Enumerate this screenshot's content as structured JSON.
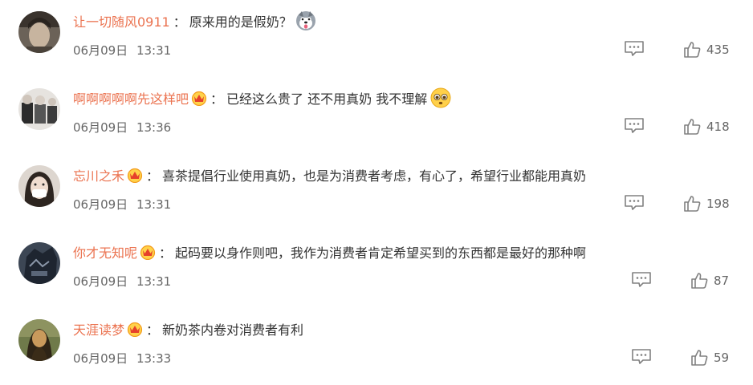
{
  "comments": [
    {
      "user": "让一切随风0911",
      "colon": "：",
      "text": "原来用的是假奶？",
      "emoji": "husky-emoji",
      "date": "06月09日",
      "time": "13:31",
      "likes": "435",
      "vip": false
    },
    {
      "user": "啊啊啊啊啊先这样吧",
      "colon": "：",
      "text": "已经这么贵了 还不用真奶 我不理解",
      "emoji": "pleading-face-emoji",
      "date": "06月09日",
      "time": "13:36",
      "likes": "418",
      "vip": true
    },
    {
      "user": "忘川之禾",
      "colon": "：",
      "text": "喜茶提倡行业使用真奶，也是为消费者考虑，有心了，希望行业都能用真奶",
      "emoji": "",
      "date": "06月09日",
      "time": "13:31",
      "likes": "198",
      "vip": true
    },
    {
      "user": "你才无知呢",
      "colon": "：",
      "text": "起码要以身作则吧，我作为消费者肯定希望买到的东西都是最好的那种啊",
      "emoji": "",
      "date": "06月09日",
      "time": "13:31",
      "likes": "87",
      "vip": true
    },
    {
      "user": "天涯读梦",
      "colon": "：",
      "text": "新奶茶内卷对消费者有利",
      "emoji": "",
      "date": "06月09日",
      "time": "13:33",
      "likes": "59",
      "vip": true
    }
  ],
  "colors": {
    "username": "#eb7350",
    "text": "#333333",
    "meta": "#666666",
    "vip_crown": "#f5a623"
  },
  "icons": {
    "reply": "comment-reply-icon",
    "like": "thumbs-up-icon",
    "vip": "vip-crown-icon"
  }
}
